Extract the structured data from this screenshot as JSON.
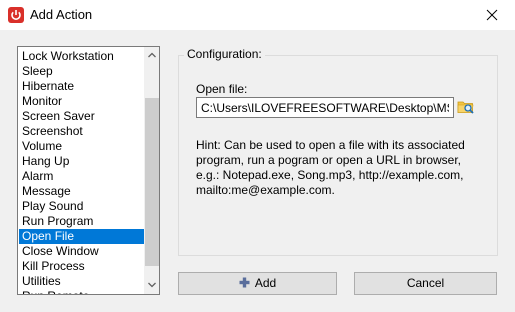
{
  "window": {
    "title": "Add Action",
    "app_icon": "power-icon",
    "close_icon": "close-icon"
  },
  "actions": {
    "items": [
      "Lock Workstation",
      "Sleep",
      "Hibernate",
      "Monitor",
      "Screen Saver",
      "Screenshot",
      "Volume",
      "Hang Up",
      "Alarm",
      "Message",
      "Play Sound",
      "Run Program",
      "Open File",
      "Close Window",
      "Kill Process",
      "Utilities",
      "Run Remote"
    ],
    "selected": "Open File",
    "selected_color": "#0078d7"
  },
  "config": {
    "group_label": "Configuration:",
    "open_file_label": "Open file:",
    "file_path": "C:\\Users\\ILOVEFREESOFTWARE\\Desktop\\MS Ap",
    "browse_icon": "folder-search-icon",
    "hint": "Hint: Can be used to open a file with its associated program, run a pogram or open a URL in browser, e.g.: Notepad.exe, Song.mp3, http://example.com, mailto:me@example.com."
  },
  "buttons": {
    "add_label": "Add",
    "add_icon": "plus-icon",
    "cancel_label": "Cancel"
  }
}
